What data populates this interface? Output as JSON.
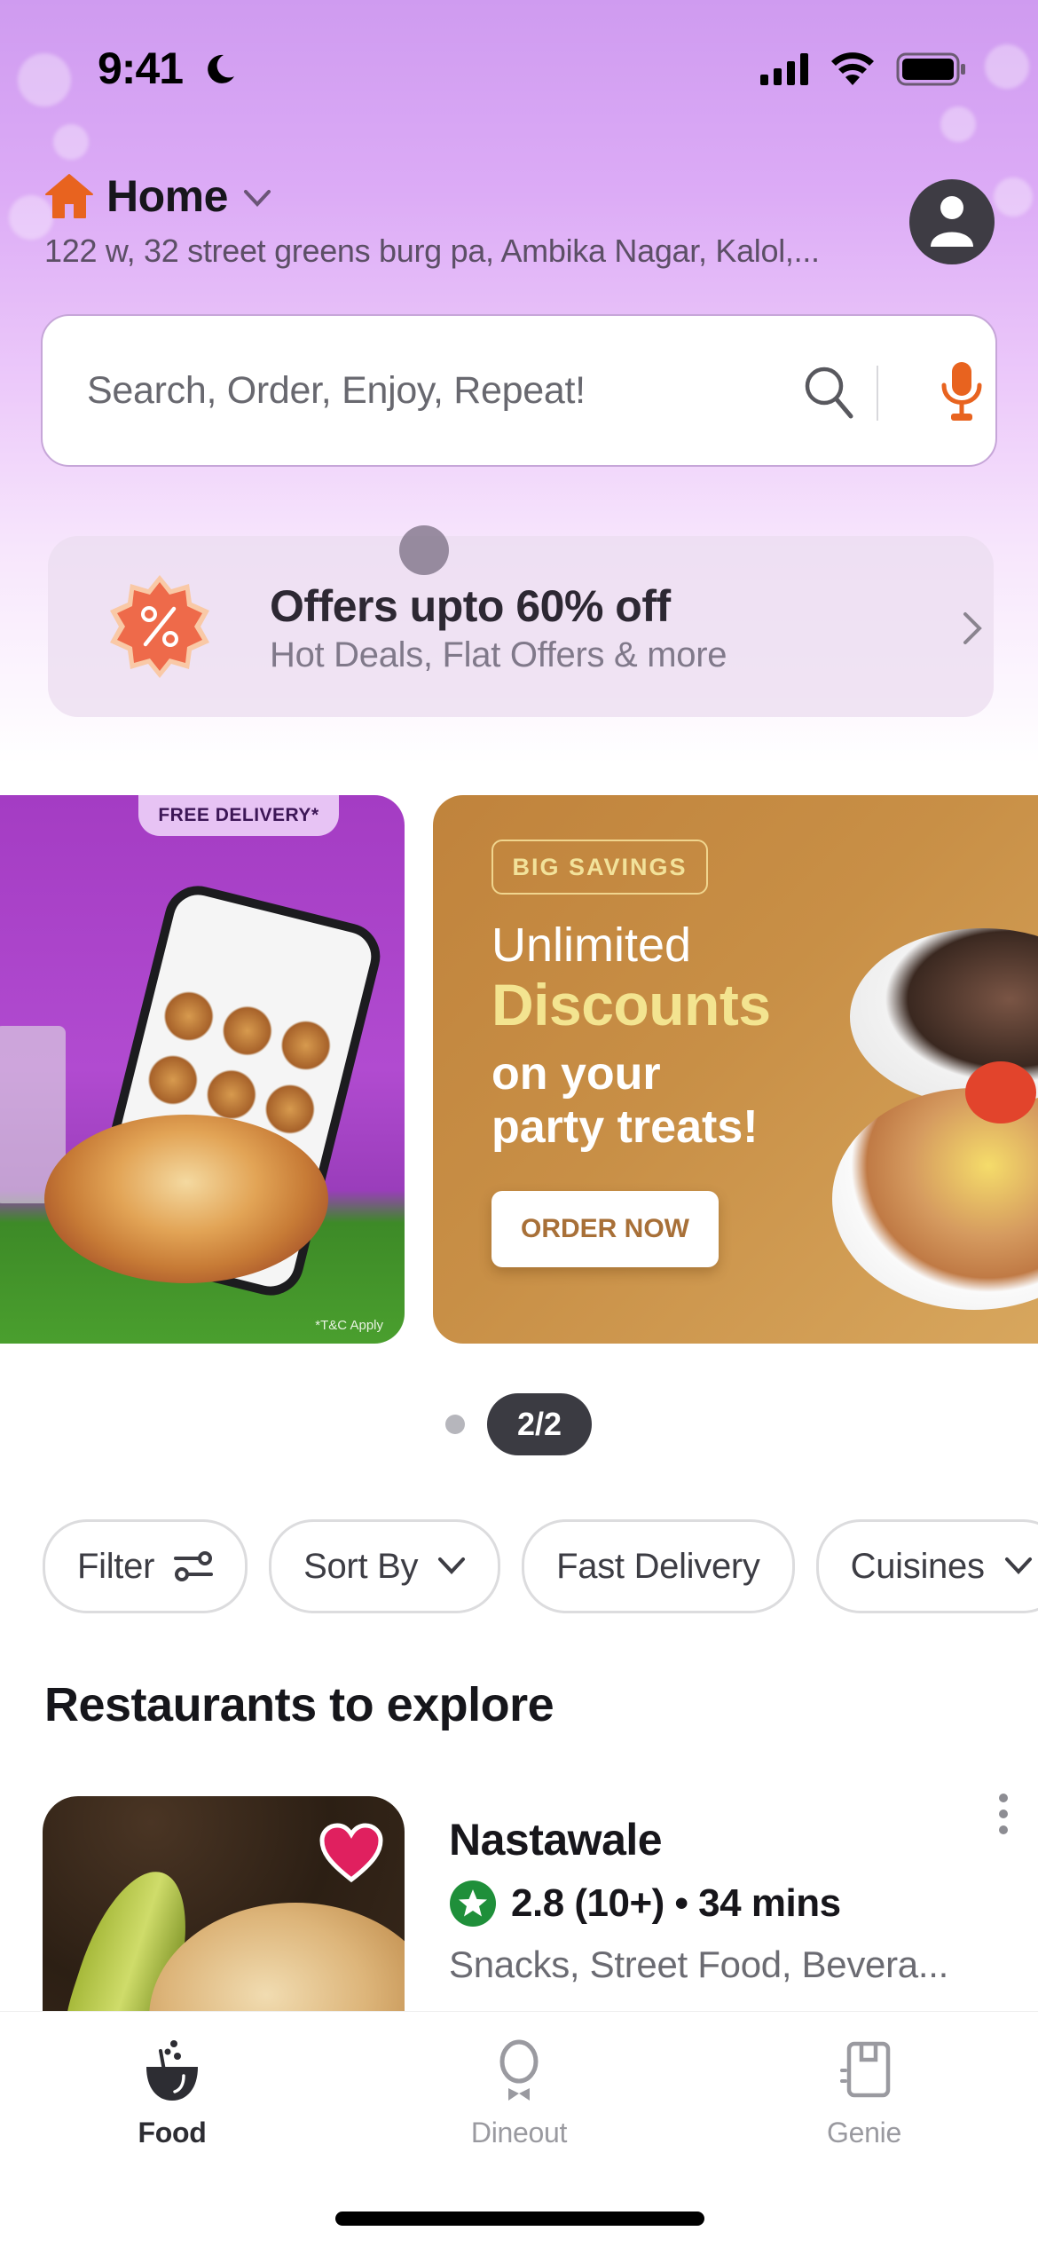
{
  "status_bar": {
    "time": "9:41",
    "focus_icon": "moon-icon",
    "signal_icon": "cellular-signal-icon",
    "wifi_icon": "wifi-icon",
    "battery_icon": "battery-icon"
  },
  "header": {
    "location_icon": "home-icon",
    "location_label": "Home",
    "address": "122 w, 32 street greens burg pa, Ambika Nagar, Kalol,...",
    "profile_icon": "user-avatar-icon"
  },
  "search": {
    "placeholder": "Search, Order, Enjoy, Repeat!",
    "value": "",
    "search_icon": "search-icon",
    "voice_icon": "microphone-icon"
  },
  "offers": {
    "icon": "discount-badge-icon",
    "title": "Offers upto 60% off",
    "subtitle": "Hot Deals, Flat Offers & more"
  },
  "banners": [
    {
      "tag": "FREE DELIVERY*",
      "disclaimer": "*T&C Apply"
    },
    {
      "tag": "BIG SAVINGS",
      "line1": "Unlimited",
      "line2": "Discounts",
      "line3": "on your",
      "line4": "party treats!",
      "cta": "ORDER NOW"
    }
  ],
  "pager": {
    "current": 2,
    "total": 2,
    "label": "2/2"
  },
  "filters": [
    {
      "label": "Filter",
      "icon": "sliders-icon"
    },
    {
      "label": "Sort By",
      "icon": "chevron-down-icon"
    },
    {
      "label": "Fast Delivery"
    },
    {
      "label": "Cuisines",
      "icon": "chevron-down-icon"
    }
  ],
  "section_title": "Restaurants to explore",
  "restaurants": [
    {
      "name": "Nastawale",
      "rating": "2.8",
      "rating_count": "(10+)",
      "eta": "34 mins",
      "rating_line": "2.8 (10+) • 34 mins",
      "cuisines": "Snacks, Street Food, Bevera...",
      "favorited": true
    }
  ],
  "bottom_nav": [
    {
      "label": "Food",
      "icon": "food-bowl-icon",
      "active": true
    },
    {
      "label": "Dineout",
      "icon": "dineout-waiter-icon",
      "active": false
    },
    {
      "label": "Genie",
      "icon": "genie-package-icon",
      "active": false
    }
  ],
  "colors": {
    "accent_orange": "#e8631f",
    "rating_green": "#1f8f3a",
    "heart_pink": "#e0205f",
    "nav_active": "#2d2d33",
    "nav_inactive": "#9a9aa0"
  }
}
